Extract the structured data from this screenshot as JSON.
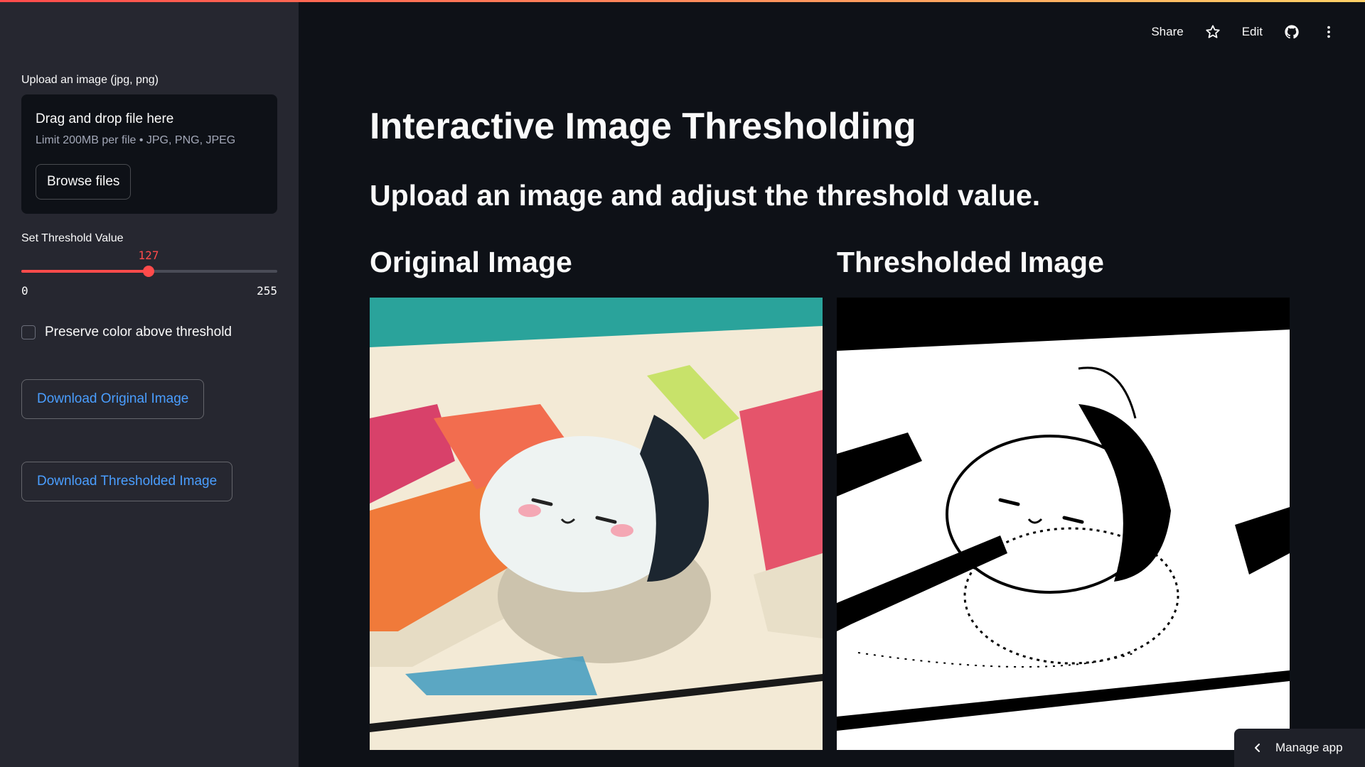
{
  "sidebar": {
    "upload_label": "Upload an image (jpg, png)",
    "dropzone_title": "Drag and drop file here",
    "dropzone_limit": "Limit 200MB per file • JPG, PNG, JPEG",
    "browse_label": "Browse files",
    "slider_label": "Set Threshold Value",
    "slider_value": "127",
    "slider_min": "0",
    "slider_max": "255",
    "checkbox_label": "Preserve color above threshold",
    "checkbox_checked": false,
    "download_original_label": "Download Original Image",
    "download_thresholded_label": "Download Thresholded Image"
  },
  "toolbar": {
    "share_label": "Share",
    "star_icon": "star-icon",
    "edit_label": "Edit",
    "github_icon": "github-icon",
    "menu_icon": "kebab-menu-icon"
  },
  "main": {
    "title": "Interactive Image Thresholding",
    "subtitle": "Upload an image and adjust the threshold value.",
    "col1_title": "Original Image",
    "col2_title": "Thresholded Image"
  },
  "manage_app": {
    "label": "Manage app",
    "icon": "chevron-left-icon"
  },
  "colors": {
    "accent": "#ff4b4b",
    "link": "#4a9eff",
    "background": "#0e1117",
    "sidebar": "#262730"
  }
}
